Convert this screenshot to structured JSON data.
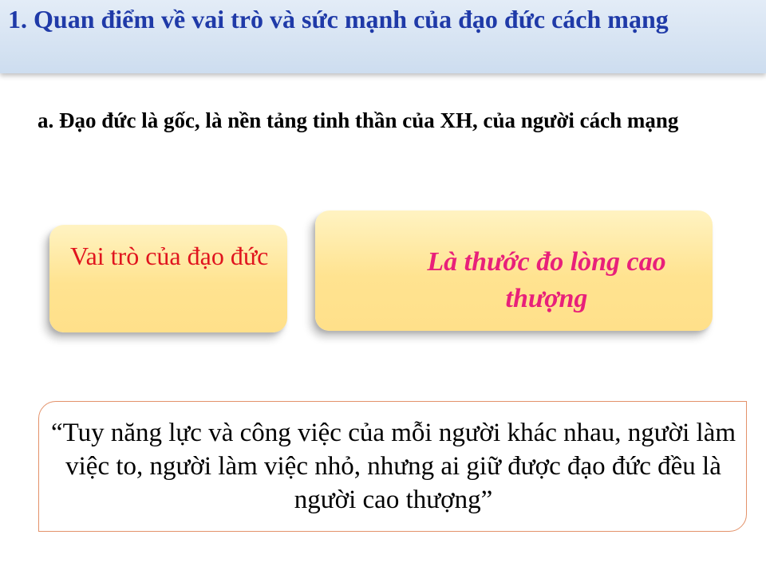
{
  "header": {
    "title": "1. Quan điểm về vai trò và sức mạnh của đạo đức cách mạng"
  },
  "content": {
    "subheading": "a. Đạo đức là gốc, là nền tảng tinh thần của XH, của người cách mạng",
    "role_box": {
      "label": "Vai trò của đạo đức"
    },
    "measure_box": {
      "label": "Là thước đo lòng cao thượng"
    },
    "quote": {
      "text": "“Tuy năng lực và công việc của mỗi người khác nhau, người làm việc to, người làm việc nhỏ, nhưng ai giữ được đạo đức đều là người cao thượng”"
    }
  },
  "colors": {
    "title": "#1f3aa8",
    "title_bar": "#cdddef",
    "box_fill": "#ffe390",
    "role_text": "#e0141e",
    "measure_text": "#e8207a",
    "quote_border": "#e3926a"
  }
}
